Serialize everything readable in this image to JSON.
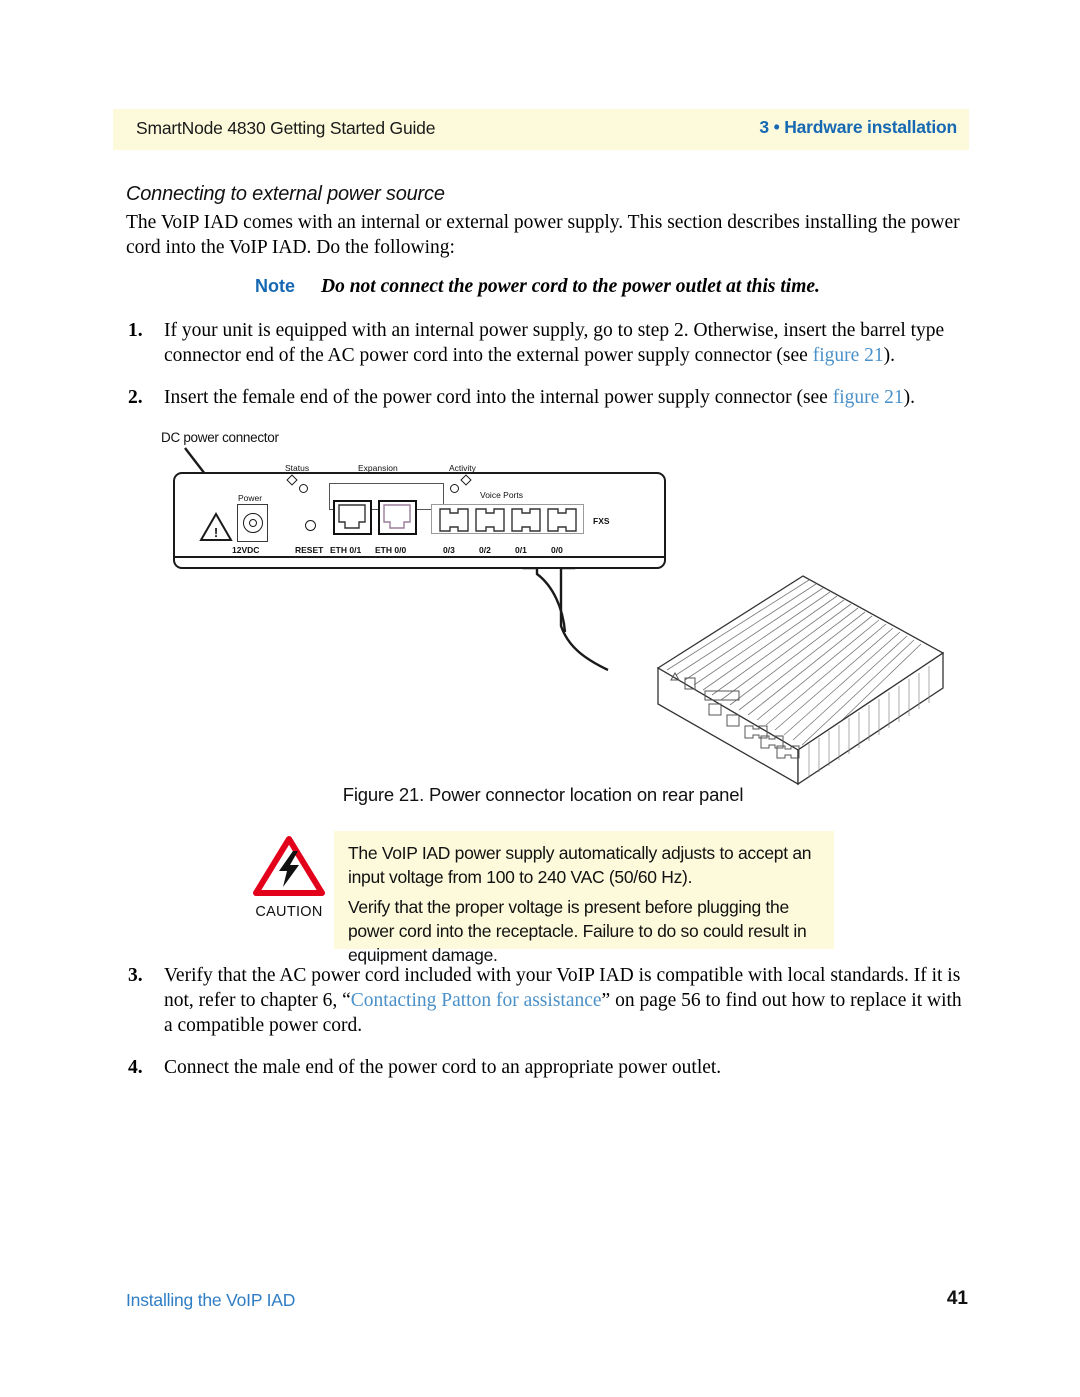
{
  "header": {
    "left_title": "SmartNode 4830 Getting Started Guide",
    "right_title": "3 • Hardware installation",
    "band_color": "#fcfadb",
    "right_color": "#1668b3"
  },
  "section": {
    "heading": "Connecting to external power source",
    "intro": "The VoIP IAD comes with an internal or external power supply. This section describes installing the power cord into the VoIP IAD. Do the following:"
  },
  "note": {
    "label": "Note",
    "text": "Do not connect the power cord to the power outlet at this time."
  },
  "steps_top": [
    {
      "num": "1.",
      "text_before": "If your unit is equipped with an internal power supply, go to step 2. Otherwise, insert the barrel type connector end of the AC power cord into the external power supply connector (see ",
      "link": "figure 21",
      "text_after": ")."
    },
    {
      "num": "2.",
      "text_before": "Insert the female end of the power cord into the internal power supply connector (see ",
      "link": "figure 21",
      "text_after": ")."
    }
  ],
  "steps_bottom": [
    {
      "num": "3.",
      "text_before": "Verify that the AC power cord included with your VoIP IAD is compatible with local standards. If it is not, refer to chapter 6, “",
      "link": "Contacting Patton for assistance",
      "text_after": "” on page 56 to find out how to replace it with a compatible power cord."
    },
    {
      "num": "4.",
      "text_before": "Connect the male end of the power cord to an appropriate power outlet.",
      "link": "",
      "text_after": ""
    }
  ],
  "figure": {
    "callout": "DC power connector",
    "caption": "Figure 21. Power connector location on rear panel",
    "panel": {
      "power_label": "Power",
      "voltage_label": "12VDC",
      "status_label": "Status",
      "expansion_label": "Expansion",
      "activity_label": "Activity",
      "voice_ports_label": "Voice Ports",
      "fxs_label": "FXS",
      "reset_label": "RESET",
      "eth_labels": [
        "ETH 0/1",
        "ETH 0/0"
      ],
      "voice_port_labels": [
        "0/3",
        "0/2",
        "0/1",
        "0/0"
      ],
      "warning_glyph": "!"
    }
  },
  "caution": {
    "word": "CAUTION",
    "paragraph_1": "The VoIP IAD power supply automatically adjusts to accept an input voltage from 100 to 240 VAC (50/60 Hz).",
    "paragraph_2": "Verify that the proper voltage is present before plugging the power cord into the receptacle. Failure to do so could result in equipment damage.",
    "box_color": "#fcfadb",
    "triangle_color": "#e3001b"
  },
  "footer": {
    "left": "Installing the VoIP IAD",
    "page_number": "41",
    "left_color": "#2f7dc4"
  }
}
